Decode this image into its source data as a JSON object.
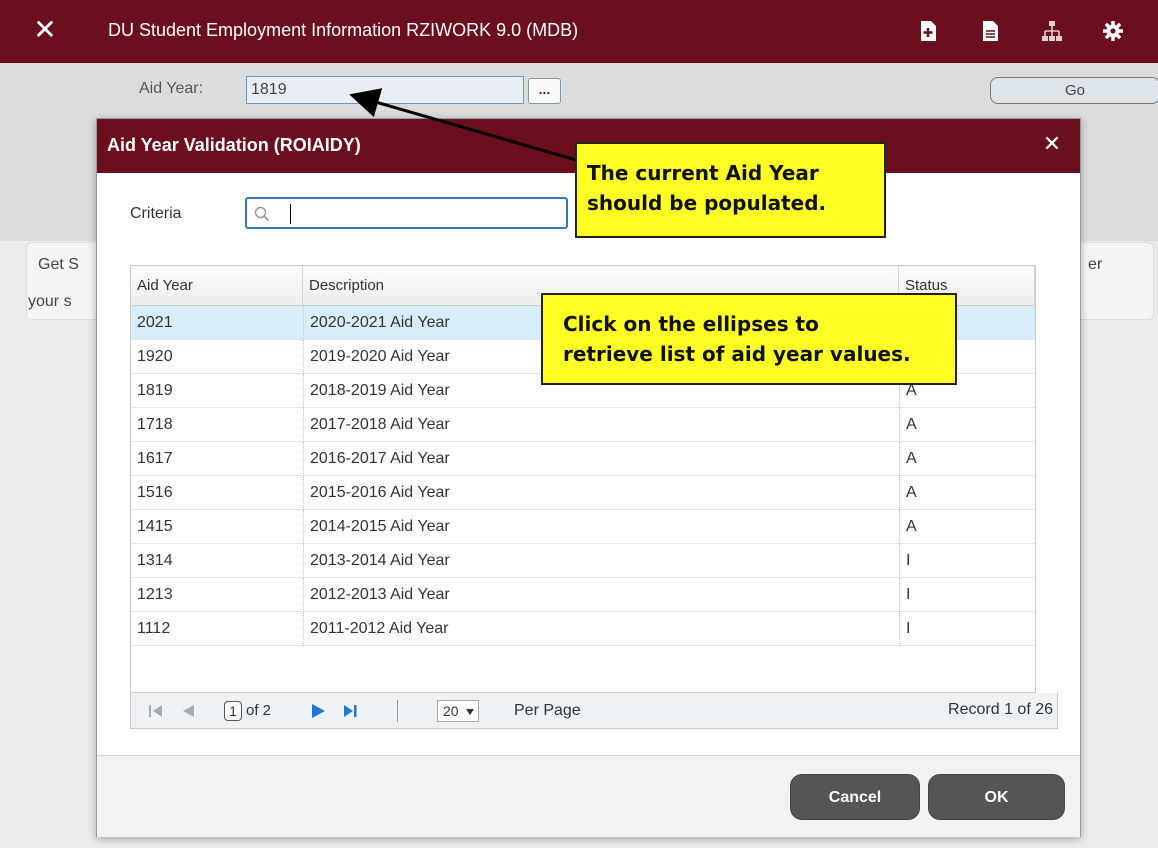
{
  "topbar": {
    "title": "DU Student Employment Information RZIWORK 9.0 (MDB)",
    "icons": [
      "close-icon",
      "add-icon",
      "document-icon",
      "hierarchy-icon",
      "gear-icon"
    ]
  },
  "key_block": {
    "aid_year_label": "Aid Year:",
    "aid_year_value": "1819",
    "ellipsis_label": "...",
    "go_label": "Go"
  },
  "background": {
    "text_left_1": "Get S",
    "text_left_2": "your s",
    "text_right": "er"
  },
  "modal": {
    "title": "Aid Year Validation (ROIAIDY)",
    "criteria_label": "Criteria",
    "criteria_value": "",
    "columns": [
      "Aid Year",
      "Description",
      "Status"
    ],
    "rows": [
      {
        "year": "2021",
        "desc": "2020-2021 Aid Year",
        "status": ""
      },
      {
        "year": "1920",
        "desc": "2019-2020 Aid Year",
        "status": ""
      },
      {
        "year": "1819",
        "desc": "2018-2019 Aid Year",
        "status": "A"
      },
      {
        "year": "1718",
        "desc": "2017-2018 Aid Year",
        "status": "A"
      },
      {
        "year": "1617",
        "desc": "2016-2017 Aid Year",
        "status": "A"
      },
      {
        "year": "1516",
        "desc": "2015-2016 Aid Year",
        "status": "A"
      },
      {
        "year": "1415",
        "desc": "2014-2015 Aid Year",
        "status": "A"
      },
      {
        "year": "1314",
        "desc": "2013-2014 Aid Year",
        "status": "I"
      },
      {
        "year": "1213",
        "desc": "2012-2013 Aid Year",
        "status": "I"
      },
      {
        "year": "1112",
        "desc": "2011-2012 Aid Year",
        "status": "I"
      }
    ],
    "pager": {
      "current_page": "1",
      "of_text": "of 2",
      "page_size": "20",
      "per_page_label": "Per Page",
      "record_text": "Record 1 of 26"
    },
    "cancel_label": "Cancel",
    "ok_label": "OK"
  },
  "annotations": {
    "callout_1_line1": "The current Aid Year",
    "callout_1_line2": "should be populated.",
    "callout_2_line1": "Click on the ellipses to",
    "callout_2_line2": "retrieve list of aid year values."
  },
  "colors": {
    "header_maroon": "#6b0f1f",
    "selected_row": "#d7edf9",
    "callout_yellow": "#ffff26",
    "pager_blue": "#1f7ad1"
  }
}
